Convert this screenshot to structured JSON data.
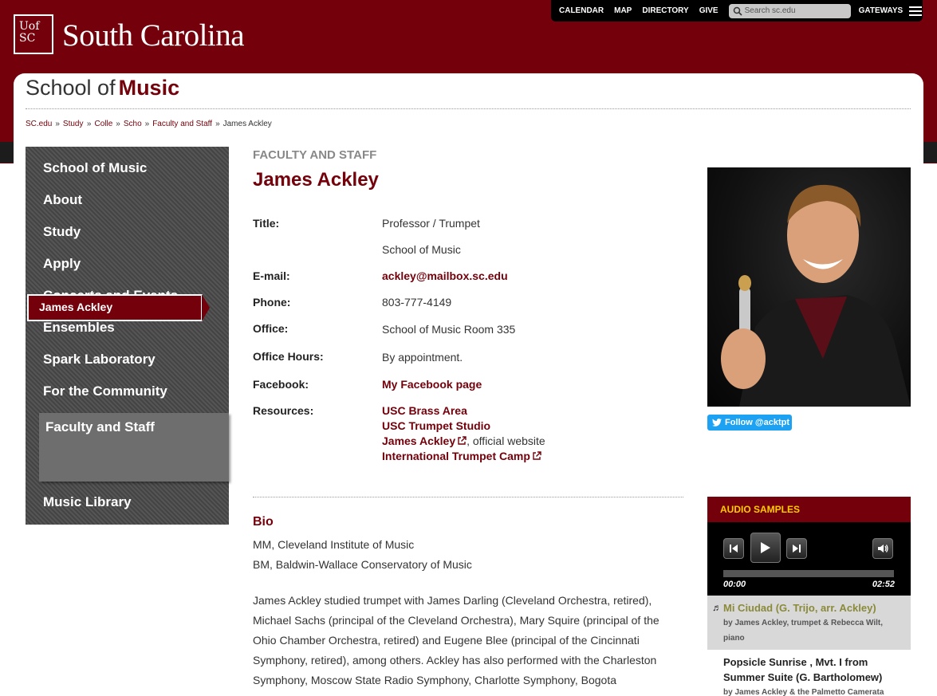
{
  "header": {
    "logo": {
      "line1": "UofSC",
      "l1a": "Uof",
      "l2a": "SC"
    },
    "site_title": "South Carolina",
    "utility_links": [
      "CALENDAR",
      "MAP",
      "DIRECTORY",
      "GIVE"
    ],
    "search_placeholder": "Search sc.edu",
    "gateways_label": "GATEWAYS",
    "brand_color": "#73000a"
  },
  "unit": {
    "prefix": "School of",
    "name": "Music"
  },
  "breadcrumb": [
    "SC.edu",
    "Study",
    "Colle",
    "Scho",
    "Faculty and Staff",
    "James Ackley"
  ],
  "sidebar": {
    "items": [
      "School of Music",
      "About",
      "Study",
      "Apply",
      "Concerts and Events",
      "Ensembles",
      "Spark Laboratory",
      "For the Community"
    ],
    "section": "Faculty and Staff",
    "current": "James Ackley",
    "after": "Music Library"
  },
  "profile": {
    "kicker": "FACULTY AND STAFF",
    "name": "James Ackley",
    "fields": {
      "title_label": "Title:",
      "title_value": "Professor / Trumpet",
      "dept_value": "School of Music",
      "email_label": "E-mail:",
      "email_value": "ackley@mailbox.sc.edu",
      "phone_label": "Phone:",
      "phone_value": "803-777-4149",
      "office_label": "Office:",
      "office_value": "School of Music Room 335",
      "hours_label": "Office Hours:",
      "hours_value": "By appointment.",
      "facebook_label": "Facebook:",
      "facebook_value": "My Facebook page",
      "resources_label": "Resources:"
    },
    "resources": {
      "r1": "USC Brass Area",
      "r2": "USC Trumpet Studio",
      "r3": "James Ackley",
      "r3_suffix": ", official website",
      "r4": "International Trumpet Camp"
    }
  },
  "bio": {
    "heading": "Bio",
    "degree1": "MM, Cleveland Institute of Music",
    "degree2": "BM, Baldwin-Wallace Conservatory of Music",
    "paragraph": "James Ackley studied trumpet with James Darling (Cleveland Orchestra, retired), Michael Sachs (principal of the Cleveland Orchestra), Mary Squire (principal of the Ohio Chamber Orchestra, retired) and Eugene Blee (principal of the Cincinnati Symphony, retired), among others. Ackley has also performed with the Charleston Symphony, Moscow State Radio Symphony, Charlotte Symphony, Bogota"
  },
  "aside": {
    "follow_label": "Follow @acktpt",
    "audio_heading": "AUDIO SAMPLES",
    "time_current": "00:00",
    "time_total": "02:52",
    "tracks": [
      {
        "title": "Mi Ciudad (G. Trijo, arr. Ackley)",
        "subtitle": "by James Ackley, trumpet & Rebecca Wilt, piano"
      },
      {
        "title": "Popsicle Sunrise , Mvt. I from Summer Suite (G. Bartholomew)",
        "subtitle": "by James Ackley & the Palmetto Camerata"
      }
    ]
  }
}
